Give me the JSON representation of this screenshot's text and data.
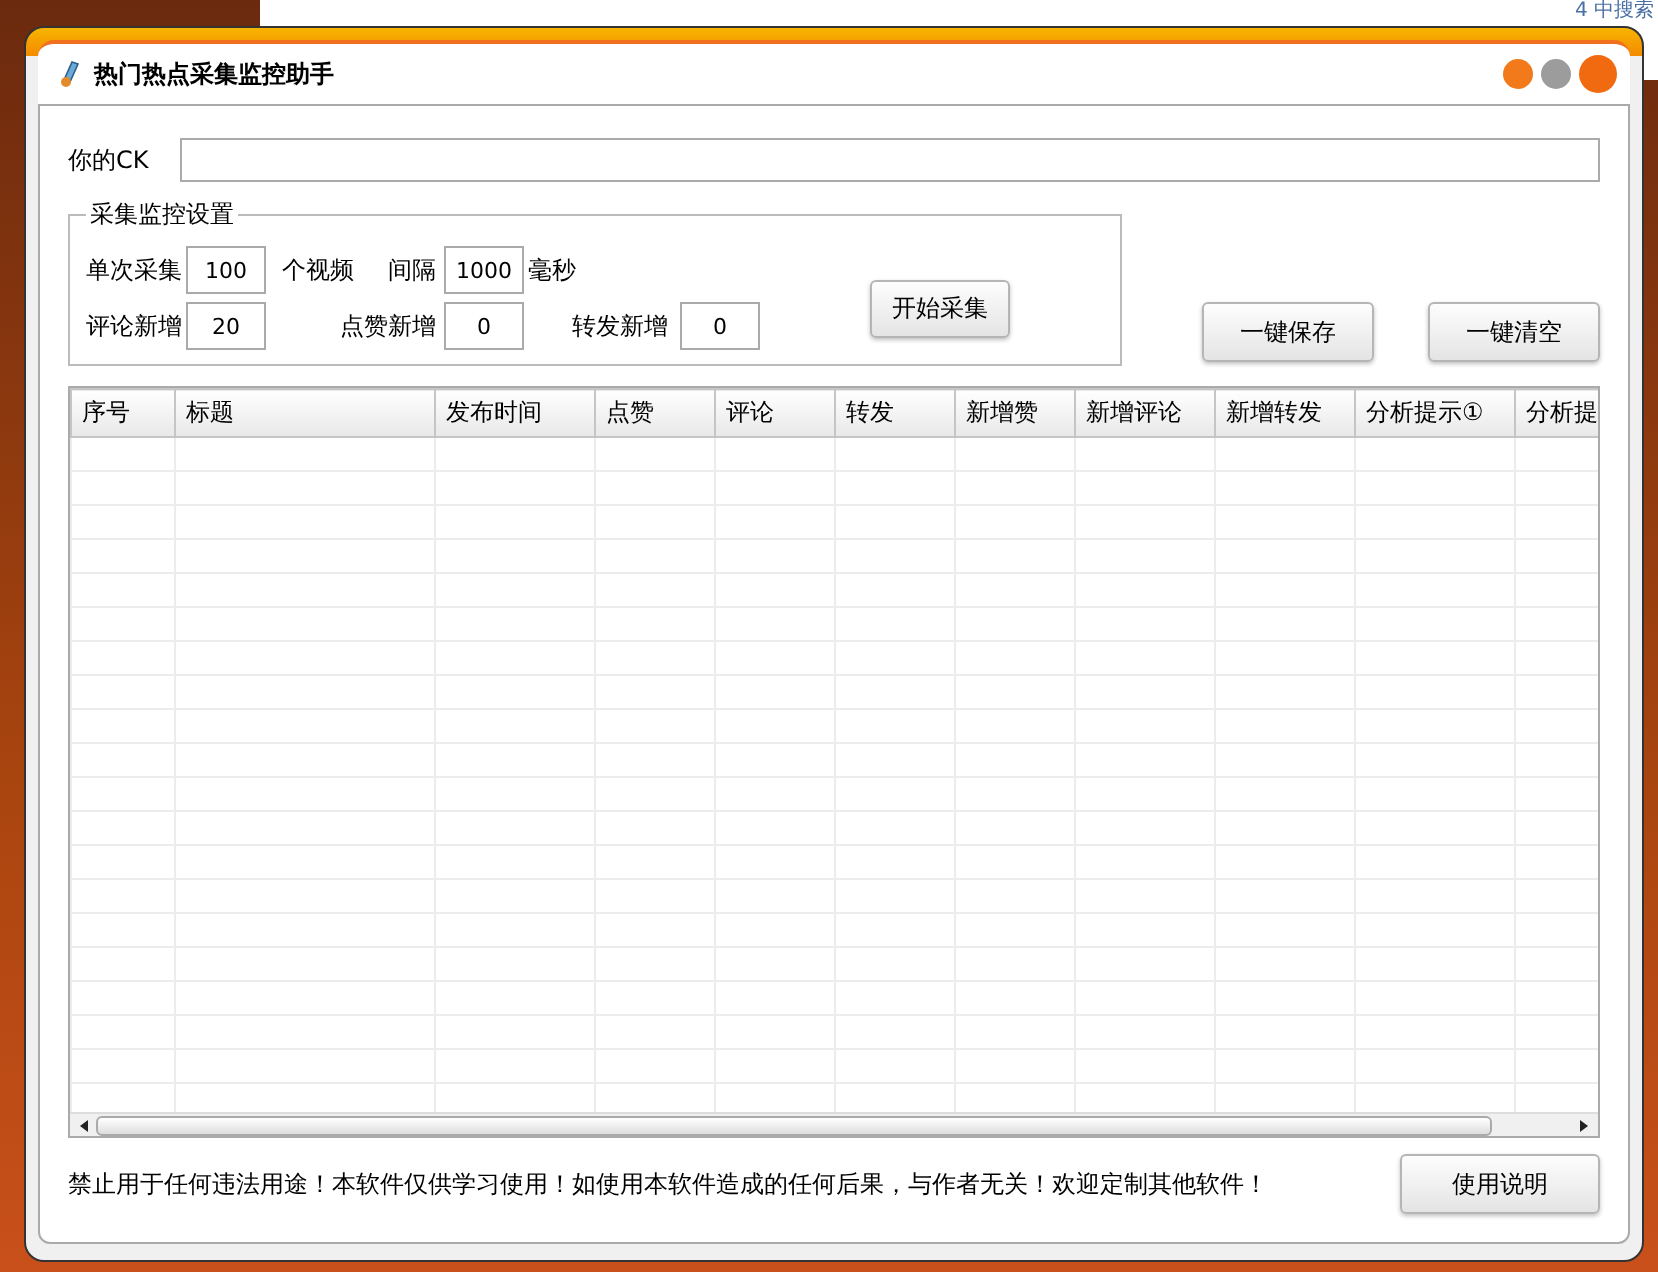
{
  "background": {
    "tab_text": "4 中搜索"
  },
  "window": {
    "title": "热门热点采集监控助手"
  },
  "ck": {
    "label": "你的CK"
  },
  "settings": {
    "title": "采集监控设置",
    "fields": [
      {
        "label": "单次采集",
        "value": "100",
        "unit": "个视频"
      },
      {
        "label": "间隔",
        "value": "1000",
        "unit": "毫秒"
      },
      {
        "label": "评论新增",
        "value": "20"
      },
      {
        "label": "点赞新增",
        "value": "0"
      },
      {
        "label": "转发新增",
        "value": "0"
      }
    ],
    "start_button": "开始采集"
  },
  "actions": [
    "一键保存",
    "一键清空"
  ],
  "table": {
    "columns": [
      "序号",
      "标题",
      "发布时间",
      "点赞",
      "评论",
      "转发",
      "新增赞",
      "新增评论",
      "新增转发",
      "分析提示①",
      "分析提"
    ]
  },
  "footer": {
    "notice": "禁止用于任何违法用途！本软件仅供学习使用！如使用本软件造成的任何后果，与作者无关！欢迎定制其他软件！",
    "help_button": "使用说明"
  }
}
